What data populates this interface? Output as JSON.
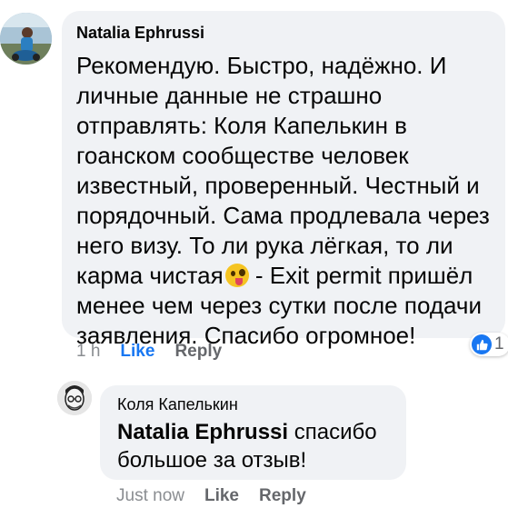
{
  "comment": {
    "author": "Natalia  Ephrussi",
    "lines": [
      "Рекомендую. Быстро, надёжно. И",
      "личные данные не страшно",
      "отправлять: Коля Капелькин в",
      "гоанском сообществе человек",
      "известный, проверенный. Честный и",
      "порядочный. Сама продлевала через",
      "него визу. То ли рука  лёгкая, то ли",
      "карма чистая",
      " - Exit permit пришёл",
      "менее чем через сутки после подачи",
      "заявления. Спасибо огромное!"
    ],
    "emoji": "winking-face-with-tongue-icon",
    "time": "1 h",
    "like_label": "Like",
    "reply_label": "Reply",
    "reaction_count": "1",
    "reaction_icon": "thumbs-up-icon"
  },
  "reply": {
    "author": "Коля Капелькин",
    "mention": "Natalia  Ephrussi",
    "line1_rest": " спасибо",
    "line2": "большое за отзыв!",
    "time": "Just now",
    "like_label": "Like",
    "reply_label": "Reply"
  },
  "colors": {
    "bubble": "#f0f2f5",
    "accent": "#1877f2",
    "meta": "#65676b"
  }
}
